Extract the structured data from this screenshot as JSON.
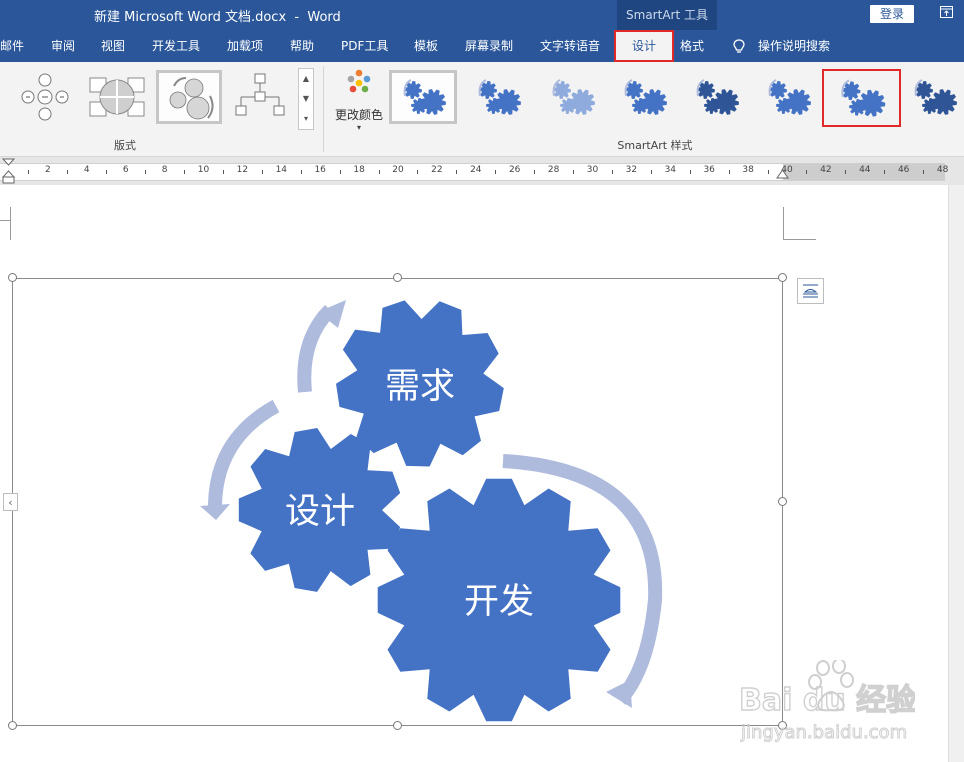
{
  "window": {
    "title": "新建 Microsoft Word 文档.docx  -  Word",
    "context_tool": "SmartArt 工具",
    "login": "登录"
  },
  "tabs": [
    {
      "label": "邮件"
    },
    {
      "label": "审阅"
    },
    {
      "label": "视图"
    },
    {
      "label": "开发工具"
    },
    {
      "label": "加载项"
    },
    {
      "label": "帮助"
    },
    {
      "label": "PDF工具"
    },
    {
      "label": "模板"
    },
    {
      "label": "屏幕录制"
    },
    {
      "label": "文字转语音"
    },
    {
      "label": "设计"
    },
    {
      "label": "格式"
    },
    {
      "label": "操作说明搜索"
    }
  ],
  "ribbon": {
    "layout_group_label": "版式",
    "styles_group_label": "SmartArt 样式",
    "change_colors_label": "更改颜色"
  },
  "ruler": {
    "numbers": [
      "2",
      "4",
      "6",
      "8",
      "10",
      "12",
      "14",
      "16",
      "18",
      "20",
      "22",
      "24",
      "26",
      "28",
      "30",
      "32",
      "34",
      "36",
      "38",
      "40",
      "42",
      "44",
      "46",
      "48"
    ]
  },
  "diagram": {
    "gears": [
      "需求",
      "设计",
      "开发"
    ],
    "colors": {
      "gear": "#4472c4",
      "arrow": "#aebbdd",
      "accent": "#2b579a",
      "highlight": "#e02a2a"
    }
  },
  "watermark": {
    "brand": "Bai du 经验",
    "url": "jingyan.baidu.com"
  }
}
